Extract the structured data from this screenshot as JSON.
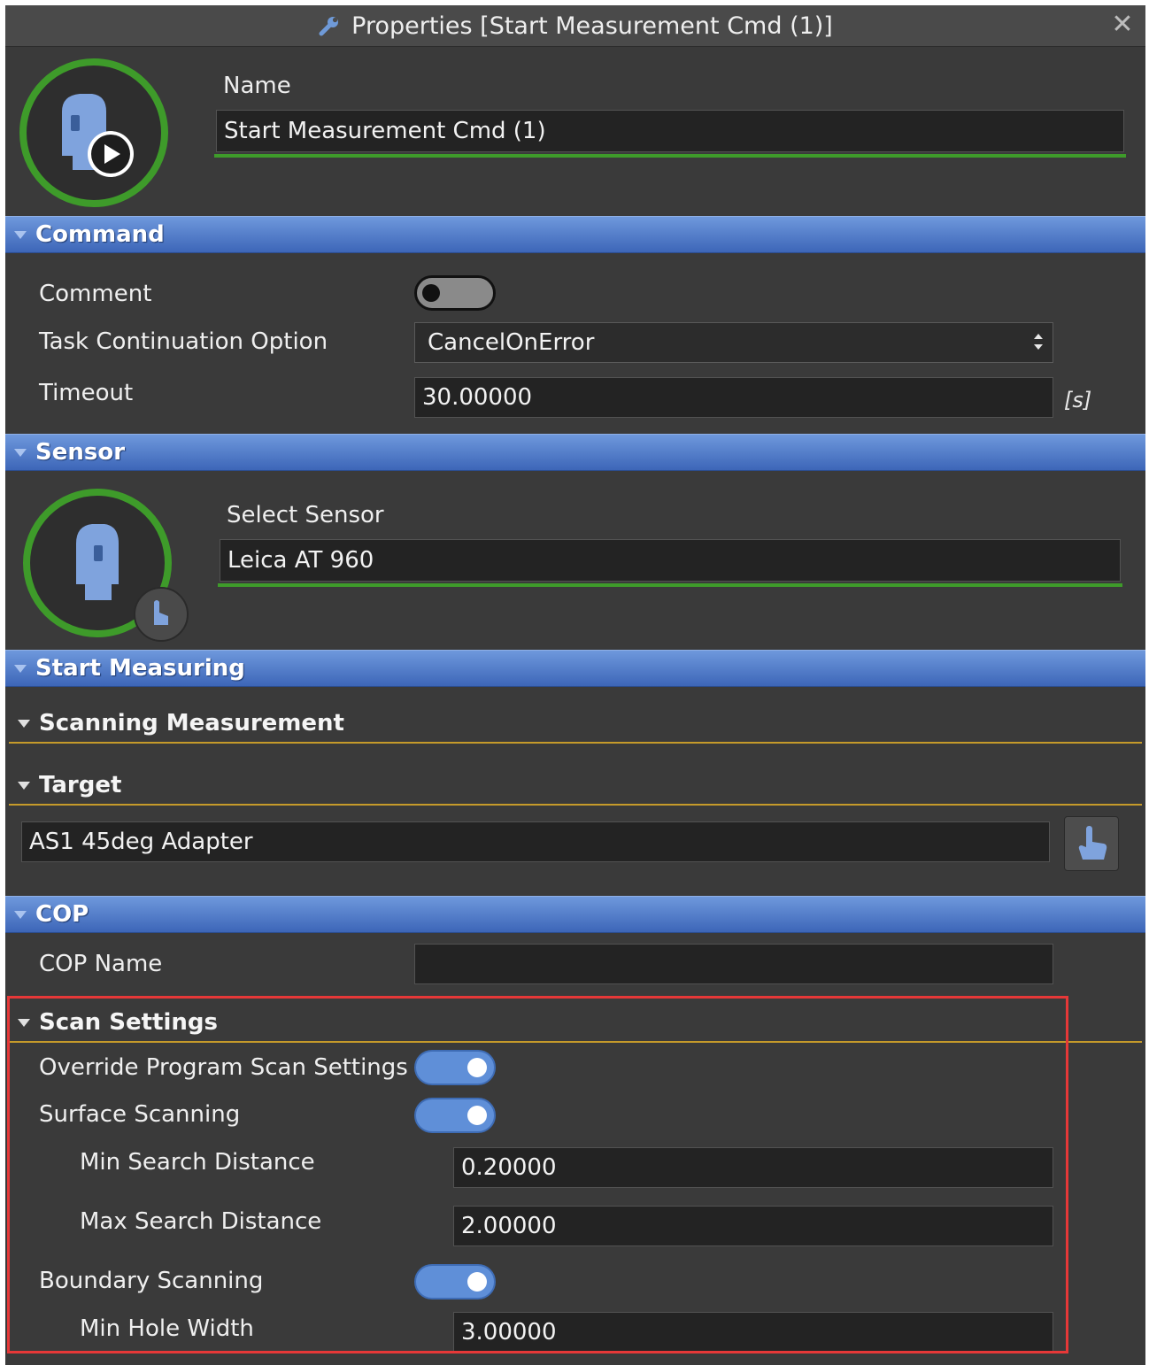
{
  "window": {
    "title": "Properties [Start Measurement Cmd (1)]",
    "close_icon": "close-icon"
  },
  "header": {
    "icon": "measurement-play-icon",
    "name_label": "Name",
    "name_value": "Start Measurement Cmd (1)"
  },
  "sections": {
    "command": "Command",
    "sensor": "Sensor",
    "start_measuring": "Start Measuring",
    "cop": "COP"
  },
  "command": {
    "comment_label": "Comment",
    "comment_on": false,
    "task_label": "Task Continuation Option",
    "task_value": "CancelOnError",
    "timeout_label": "Timeout",
    "timeout_value": "30.00000",
    "timeout_unit": "[s]"
  },
  "sensor": {
    "icon": "laser-tracker-icon",
    "select_label": "Select Sensor",
    "select_value": "Leica AT 960"
  },
  "start_measuring": {
    "scanning_title": "Scanning Measurement",
    "target_title": "Target",
    "target_value": "AS1 45deg Adapter"
  },
  "cop": {
    "name_label": "COP Name",
    "name_value": ""
  },
  "scan_settings": {
    "title": "Scan Settings",
    "override_label": "Override Program Scan Settings",
    "override_on": true,
    "surface_label": "Surface Scanning",
    "surface_on": true,
    "min_search_label": "Min Search Distance",
    "min_search_value": "0.20000",
    "max_search_label": "Max Search Distance",
    "max_search_value": "2.00000",
    "boundary_label": "Boundary Scanning",
    "boundary_on": true,
    "min_hole_label": "Min Hole Width",
    "min_hole_value": "3.00000"
  },
  "colors": {
    "panel_bg": "#3a3a3a",
    "section_blue": "#4a73c2",
    "accent_green": "#3e9b2a",
    "subsection_gold": "#c59a2a",
    "highlight_red": "#e63838",
    "toggle_on": "#5f8fd8"
  }
}
